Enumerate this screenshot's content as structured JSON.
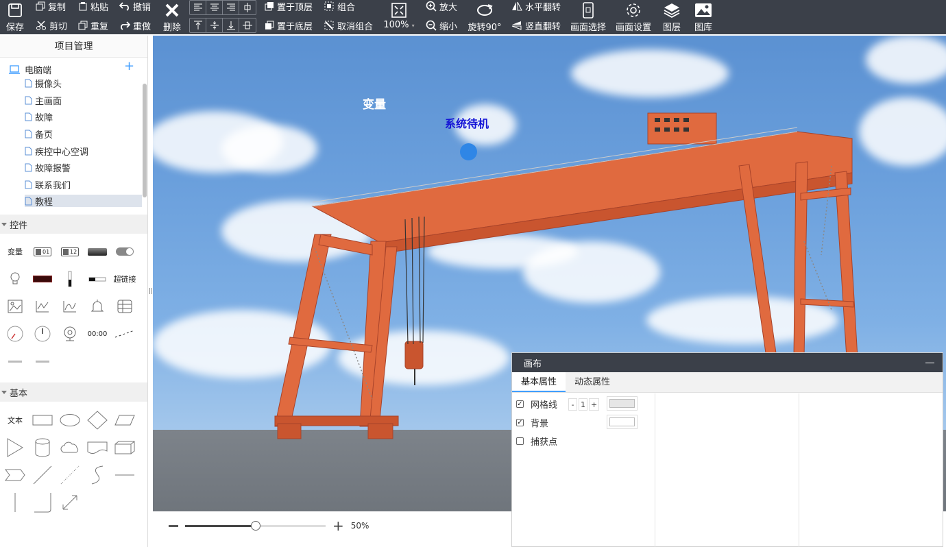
{
  "toolbar": {
    "save": "保存",
    "copy": "复制",
    "paste": "粘贴",
    "undo": "撤销",
    "cut": "剪切",
    "duplicate": "重复",
    "redo": "重做",
    "delete": "删除",
    "bring_top": "置于顶层",
    "send_bottom": "置于底层",
    "group": "组合",
    "ungroup": "取消组合",
    "zoom_level": "100%",
    "zoom_in": "放大",
    "zoom_out": "缩小",
    "rotate": "旋转90°",
    "flip_h": "水平翻转",
    "flip_v": "竖直翻转",
    "screen_select": "画面选择",
    "screen_settings": "画面设置",
    "layers": "图层",
    "gallery": "图库"
  },
  "project": {
    "title": "项目管理",
    "root": "电脑端",
    "pages": [
      "摄像头",
      "主画面",
      "故障",
      "备页",
      "疾控中心空调",
      "故障报警",
      "联系我们",
      "教程"
    ],
    "selected_index": 7
  },
  "controls": {
    "title": "控件",
    "variable_label": "变量",
    "hyperlink_label": "超链接",
    "time_label": "00:00",
    "num_a": "01",
    "num_b": "12"
  },
  "basic": {
    "title": "基本",
    "text_label": "文本"
  },
  "canvas": {
    "variable_text": "变量",
    "status_text": "系统待机",
    "status_color": "#1515d6",
    "indicator_color": "#2f86e6"
  },
  "zoom": {
    "value_label": "50%",
    "fraction": 0.5
  },
  "properties": {
    "title": "画布",
    "tabs": [
      "基本属性",
      "动态属性"
    ],
    "grid_label": "网格线",
    "grid_value": "1",
    "minus": "-",
    "plus": "+",
    "background_label": "背景",
    "snap_label": "捕获点",
    "grid_checked": true,
    "background_checked": true,
    "snap_checked": false,
    "grid_color": "#e6e6e6",
    "background_color": "#ffffff"
  }
}
